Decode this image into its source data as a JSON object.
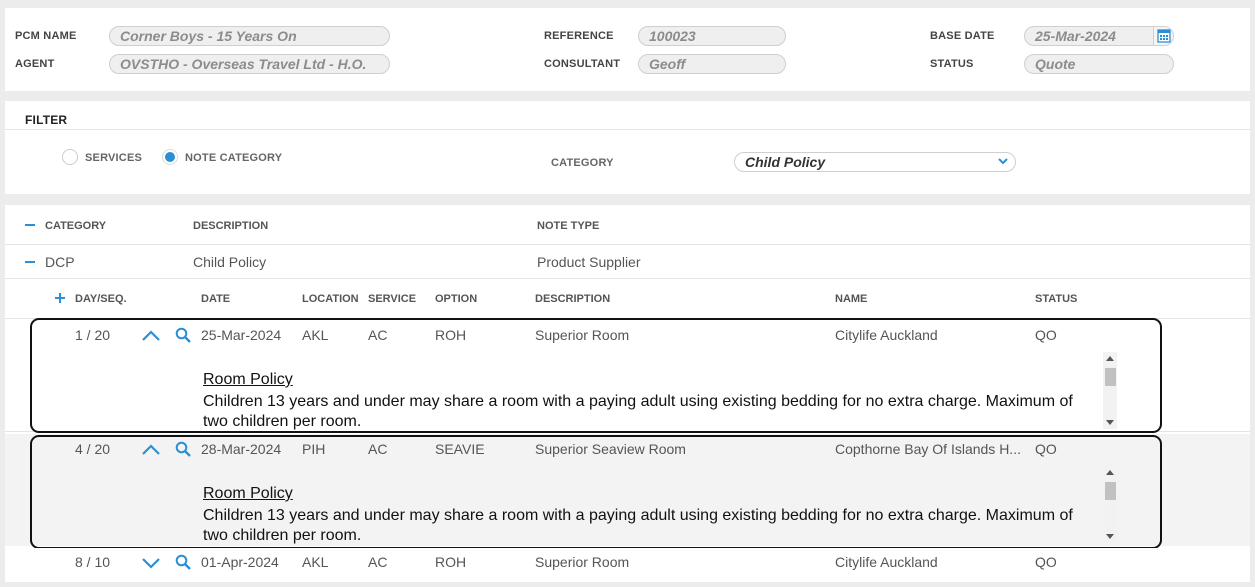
{
  "header": {
    "pcm_name_label": "PCM NAME",
    "pcm_name_value": "Corner Boys - 15 Years On",
    "agent_label": "AGENT",
    "agent_value": "OVSTHO - Overseas Travel Ltd - H.O.",
    "reference_label": "REFERENCE",
    "reference_value": "100023",
    "consultant_label": "CONSULTANT",
    "consultant_value": "Geoff",
    "base_date_label": "BASE DATE",
    "base_date_value": "25-Mar-2024",
    "status_label": "STATUS",
    "status_value": "Quote"
  },
  "filter": {
    "title": "FILTER",
    "services_label": "SERVICES",
    "note_category_label": "NOTE CATEGORY",
    "selected": "note_category",
    "category_label": "CATEGORY",
    "category_value": "Child Policy"
  },
  "category_table": {
    "headers": {
      "category": "CATEGORY",
      "description": "DESCRIPTION",
      "note_type": "NOTE TYPE"
    },
    "row": {
      "category": "DCP",
      "description": "Child Policy",
      "note_type": "Product Supplier"
    }
  },
  "services_table": {
    "headers": {
      "day_seq": "DAY/SEQ.",
      "date": "DATE",
      "location": "LOCATION",
      "service": "SERVICE",
      "option": "OPTION",
      "description": "DESCRIPTION",
      "name": "NAME",
      "status": "STATUS"
    },
    "rows": [
      {
        "day_seq": "1 / 20",
        "date": "25-Mar-2024",
        "location": "AKL",
        "service": "AC",
        "option": "ROH",
        "description": "Superior Room",
        "name": "Citylife Auckland",
        "status": "QO",
        "note_title": "Room Policy",
        "note_text": "Children 13 years and under may share a room with a paying adult using existing bedding for no extra charge. Maximum of two children per room."
      },
      {
        "day_seq": "4 / 20",
        "date": "28-Mar-2024",
        "location": "PIH",
        "service": "AC",
        "option": "SEAVIE",
        "description": "Superior Seaview Room",
        "name": "Copthorne Bay Of Islands H...",
        "status": "QO",
        "note_title": "Room Policy",
        "note_text": "Children 13 years and under may share a room with a paying adult using existing bedding for no extra charge. Maximum of two children per room."
      },
      {
        "day_seq": "8 / 10",
        "date": "01-Apr-2024",
        "location": "AKL",
        "service": "AC",
        "option": "ROH",
        "description": "Superior Room",
        "name": "Citylife Auckland",
        "status": "QO"
      }
    ]
  },
  "colors": {
    "accent": "#2b8fd6",
    "selected_row_bg": "#f3f3f3",
    "outline": "#111111"
  },
  "icons": [
    "calendar-icon",
    "chevron-down-icon",
    "chevron-up-icon",
    "search-icon"
  ]
}
